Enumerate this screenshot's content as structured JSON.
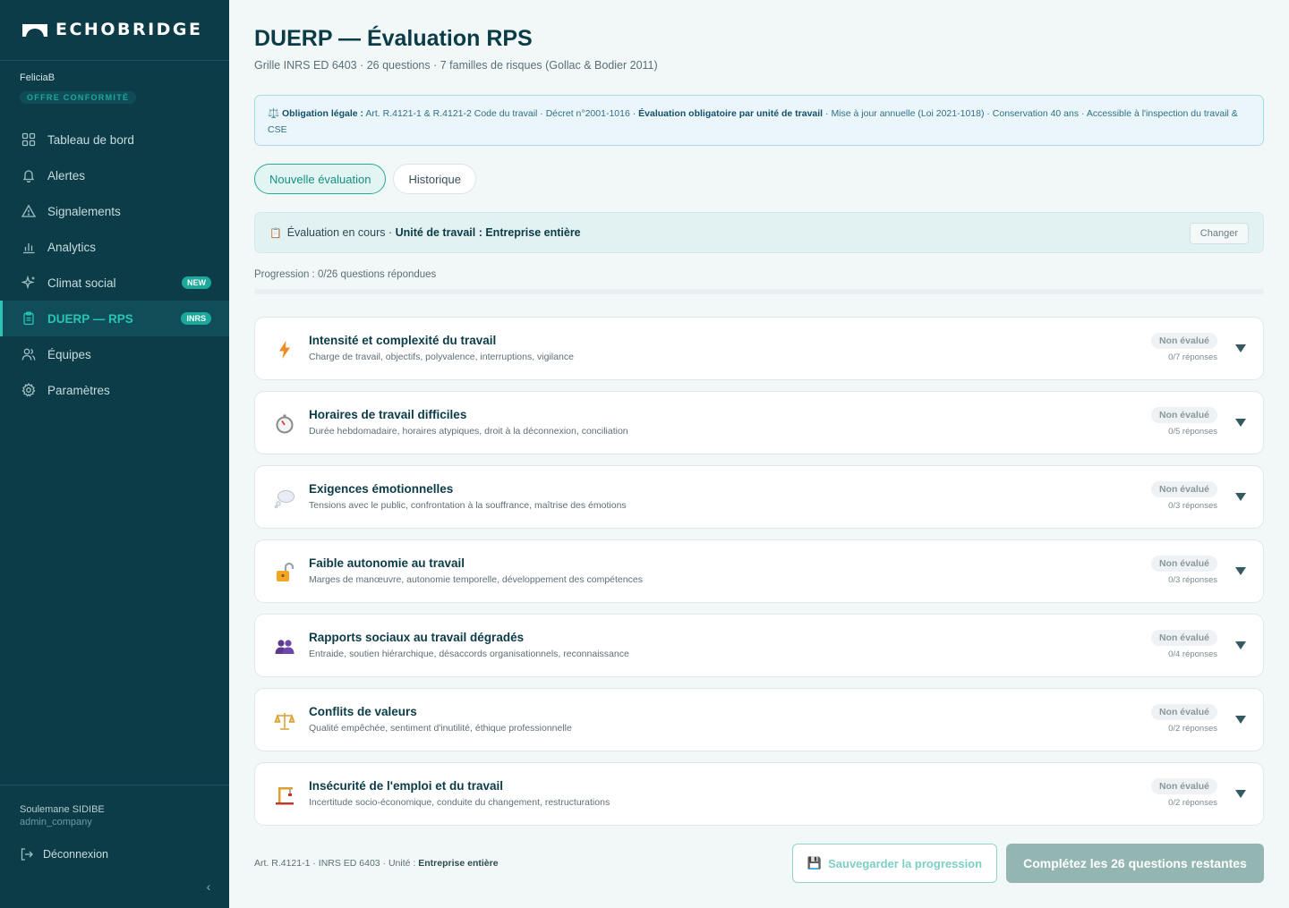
{
  "brand": {
    "name": "ECHOBRIDGE"
  },
  "user_top": {
    "username": "FeliciaB",
    "plan": "OFFRE CONFORMITÉ"
  },
  "nav": {
    "items": [
      {
        "label": "Tableau de bord",
        "icon": "grid-icon",
        "active": false
      },
      {
        "label": "Alertes",
        "icon": "bell-icon",
        "active": false
      },
      {
        "label": "Signalements",
        "icon": "warning-triangle-icon",
        "active": false
      },
      {
        "label": "Analytics",
        "icon": "bar-chart-icon",
        "active": false
      },
      {
        "label": "Climat social",
        "icon": "sparkle-icon",
        "active": false,
        "badge": "NEW"
      },
      {
        "label": "DUERP — RPS",
        "icon": "clipboard-icon",
        "active": true,
        "badge": "INRS"
      },
      {
        "label": "Équipes",
        "icon": "users-icon",
        "active": false
      },
      {
        "label": "Paramètres",
        "icon": "gear-icon",
        "active": false
      }
    ]
  },
  "user_bottom": {
    "full_name": "Soulemane SIDIBE",
    "role": "admin_company",
    "logout_label": "Déconnexion"
  },
  "page": {
    "title": "DUERP — Évaluation RPS",
    "subtitle": "Grille INRS ED 6403 · 26 questions · 7 familles de risques (Gollac & Bodier 2011)"
  },
  "legal": {
    "prefix_icon": "⚖️",
    "label": "Obligation légale :",
    "text1": " Art. R.4121-1 & R.4121-2 Code du travail · Décret n°2001-1016 · ",
    "emph": "Évaluation obligatoire par unité de travail",
    "text2": " · Mise à jour annuelle (Loi 2021-1018) · Conservation 40 ans · Accessible à l'inspection du travail & CSE"
  },
  "tabs": [
    {
      "label": "Nouvelle évaluation",
      "active": true
    },
    {
      "label": "Historique",
      "active": false
    }
  ],
  "current_eval": {
    "icon": "📋",
    "prefix": "Évaluation en cours · ",
    "unit_label": "Unité de travail : Entreprise entière",
    "change_label": "Changer"
  },
  "progress": {
    "label": "Progression : 0/26 questions répondues",
    "fraction": 0.0
  },
  "families": [
    {
      "title": "Intensité et complexité du travail",
      "desc": "Charge de travail, objectifs, polyvalence, interruptions, vigilance",
      "status": "Non évalué",
      "count": "0/7 réponses",
      "icon": "lightning-icon"
    },
    {
      "title": "Horaires de travail difficiles",
      "desc": "Durée hebdomadaire, horaires atypiques, droit à la déconnexion, conciliation",
      "status": "Non évalué",
      "count": "0/5 réponses",
      "icon": "stopwatch-icon"
    },
    {
      "title": "Exigences émotionnelles",
      "desc": "Tensions avec le public, confrontation à la souffrance, maîtrise des émotions",
      "status": "Non évalué",
      "count": "0/3 réponses",
      "icon": "thought-bubble-icon"
    },
    {
      "title": "Faible autonomie au travail",
      "desc": "Marges de manœuvre, autonomie temporelle, développement des compétences",
      "status": "Non évalué",
      "count": "0/3 réponses",
      "icon": "unlocked-padlock-icon"
    },
    {
      "title": "Rapports sociaux au travail dégradés",
      "desc": "Entraide, soutien hiérarchique, désaccords organisationnels, reconnaissance",
      "status": "Non évalué",
      "count": "0/4 réponses",
      "icon": "people-icon"
    },
    {
      "title": "Conflits de valeurs",
      "desc": "Qualité empêchée, sentiment d'inutilité, éthique professionnelle",
      "status": "Non évalué",
      "count": "0/2 réponses",
      "icon": "scales-icon"
    },
    {
      "title": "Insécurité de l'emploi et du travail",
      "desc": "Incertitude socio-économique, conduite du changement, restructurations",
      "status": "Non évalué",
      "count": "0/2 réponses",
      "icon": "construction-crane-icon"
    }
  ],
  "footer": {
    "ref_prefix": "Art. R.4121-1 · INRS ED 6403 · Unité : ",
    "ref_unit": "Entreprise entière",
    "save_icon": "💾",
    "save_label": "Sauvegarder la progression",
    "complete_label": "Complétez les 26 questions restantes"
  },
  "colors": {
    "sidebar_bg": "#0b3c47",
    "accent": "#2aa99a",
    "title": "#0b3b47",
    "legal_bg": "#ebf6fb",
    "complete_btn": "#93b6b3"
  }
}
